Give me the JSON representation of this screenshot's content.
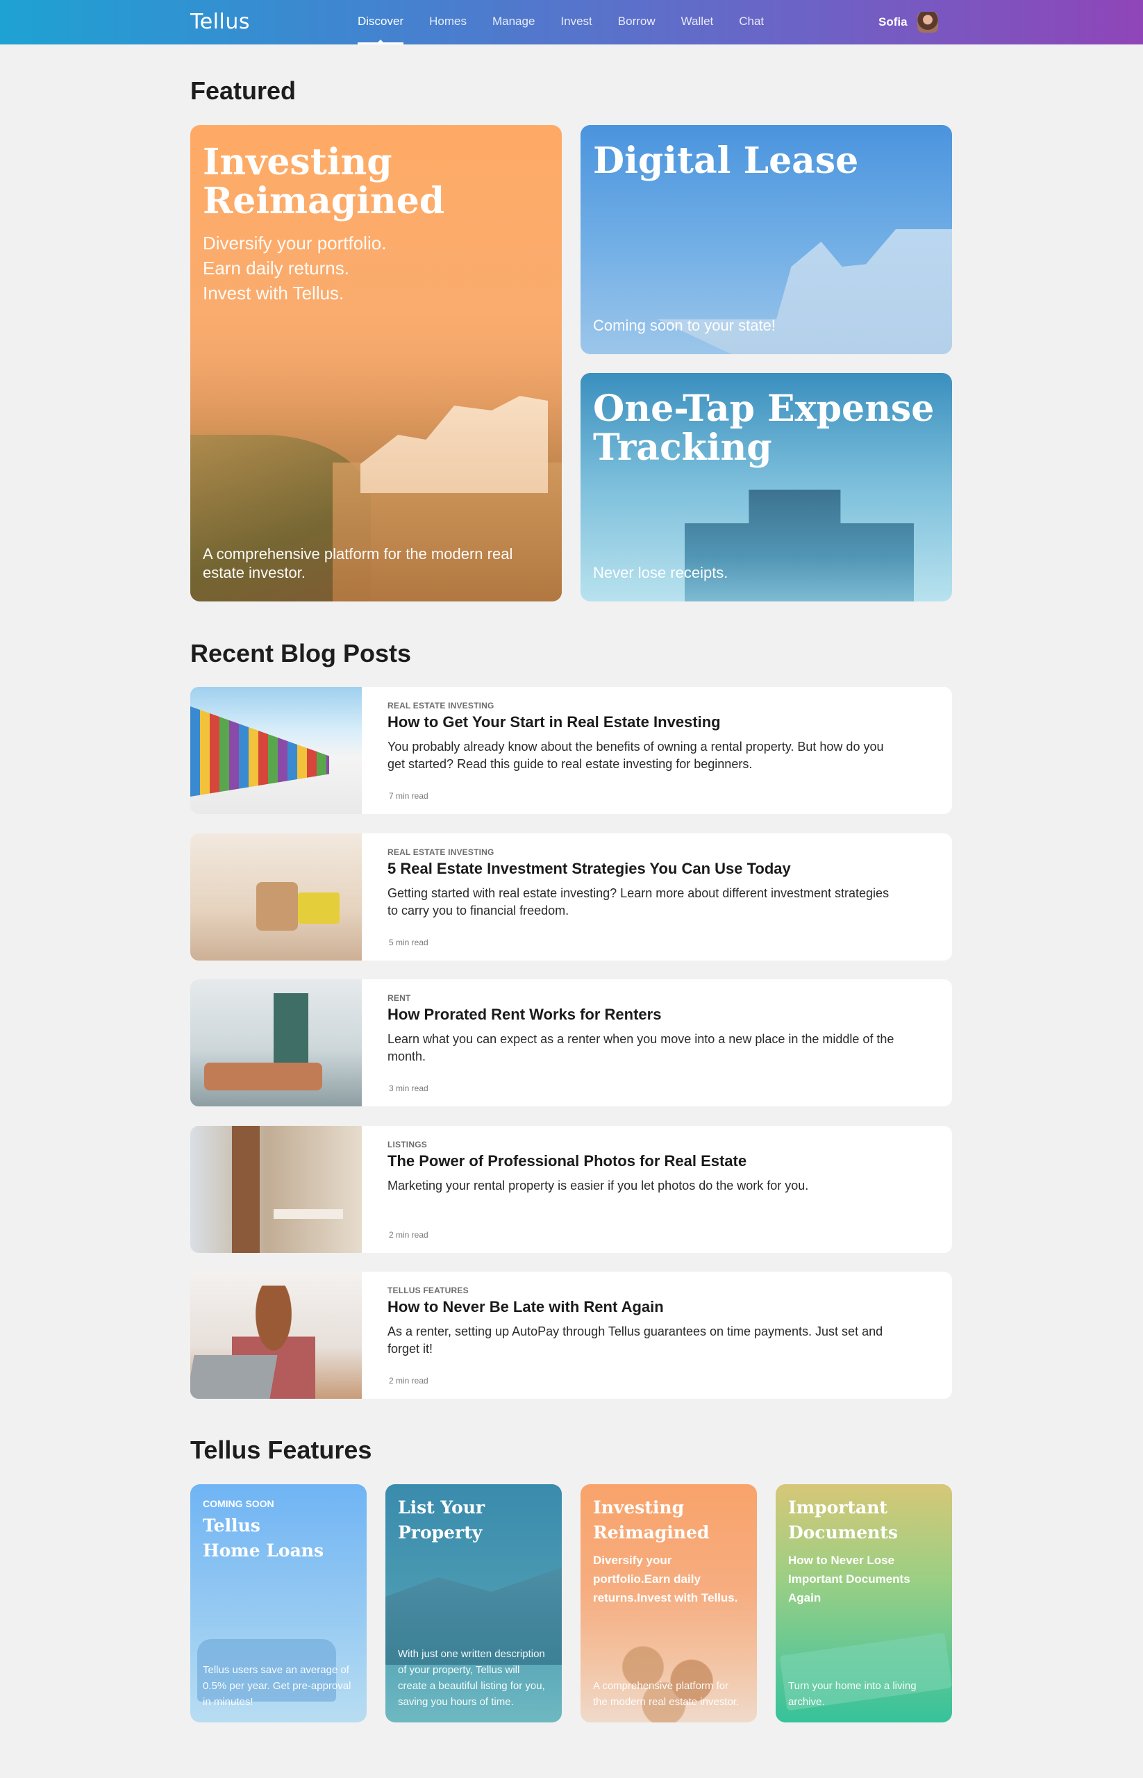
{
  "app": {
    "logo": "Tellus"
  },
  "nav": {
    "items": [
      "Discover",
      "Homes",
      "Manage",
      "Invest",
      "Borrow",
      "Wallet",
      "Chat"
    ],
    "active": "Discover"
  },
  "user": {
    "name": "Sofia"
  },
  "sections": {
    "featured": "Featured",
    "blog": "Recent Blog Posts",
    "features": "Tellus Features"
  },
  "featured": {
    "invest": {
      "title": "Investing Reimagined",
      "lines": [
        "Diversify your portfolio.",
        "Earn daily returns.",
        "Invest with Tellus."
      ],
      "footer": "A comprehensive platform for the modern real estate investor."
    },
    "lease": {
      "title": "Digital Lease",
      "footer": "Coming soon to your state!"
    },
    "expense": {
      "title": "One-Tap Expense Tracking",
      "footer": "Never lose receipts."
    }
  },
  "posts": [
    {
      "category": "REAL ESTATE INVESTING",
      "title": "How to Get Your Start in Real Estate Investing",
      "desc": "You probably already know about the benefits of owning a rental property. But how do you get started? Read this guide to real estate investing for beginners.",
      "read": "7 min read"
    },
    {
      "category": "REAL ESTATE INVESTING",
      "title": "5 Real Estate Investment Strategies You Can Use Today",
      "desc": "Getting started with real estate investing? Learn more about different investment strategies to carry you to financial freedom.",
      "read": "5 min read"
    },
    {
      "category": "RENT",
      "title": "How Prorated Rent Works for Renters",
      "desc": "Learn what you can expect as a renter when you move into a new place in the middle of the month.",
      "read": "3 min read"
    },
    {
      "category": "LISTINGS",
      "title": "The Power of Professional Photos for Real Estate",
      "desc": "Marketing your rental property is easier if you let photos do the work for you.",
      "read": "2 min read"
    },
    {
      "category": "TELLUS FEATURES",
      "title": "How to Never Be Late with Rent Again",
      "desc": "As a renter, setting up AutoPay through Tellus guarantees on time payments. Just set and forget it!",
      "read": "2 min read"
    }
  ],
  "features": {
    "loans": {
      "tag": "COMING SOON",
      "title_1": "Tellus",
      "title_2": "Home Loans",
      "footer": "Tellus users save an average of 0.5% per year. Get pre-approval in minutes!"
    },
    "list": {
      "title_1": "List Your",
      "title_2": "Property",
      "footer": "With just one written description of your property, Tellus will create a beautiful listing for you, saving you hours of time."
    },
    "invest": {
      "title_1": "Investing",
      "title_2": "Reimagined",
      "sub": "Diversify your portfolio.Earn daily returns.Invest with Tellus.",
      "footer": "A comprehensive platform for the modern real estate investor."
    },
    "docs": {
      "title_1": "Important",
      "title_2": "Documents",
      "sub": "How to Never Lose Important Documents Again",
      "footer": "Turn your home into a living archive."
    }
  }
}
